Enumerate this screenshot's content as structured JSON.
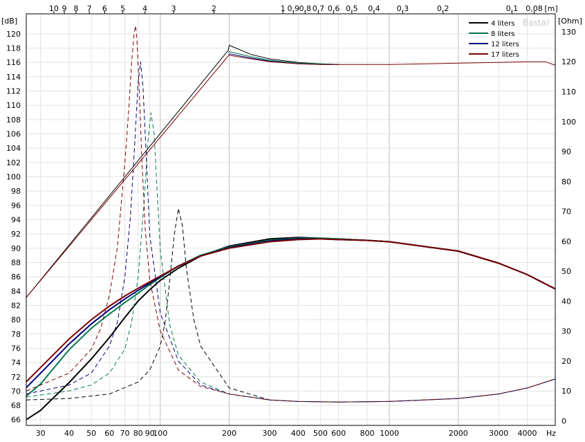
{
  "chart_data": {
    "type": "line",
    "watermark": "Basta!",
    "x_axis": {
      "unit": "Hz",
      "scale": "log",
      "range": [
        26,
        5300
      ],
      "major_ticks": [
        100,
        200,
        1000,
        2000
      ],
      "ticks": [
        {
          "value": 30,
          "label": "30"
        },
        {
          "value": 40,
          "label": "40"
        },
        {
          "value": 50,
          "label": "50"
        },
        {
          "value": 60,
          "label": "60"
        },
        {
          "value": 70,
          "label": "70"
        },
        {
          "value": 80,
          "label": "80"
        },
        {
          "value": 90,
          "label": "90"
        },
        {
          "value": 100,
          "label": "100"
        },
        {
          "value": 200,
          "label": "200"
        },
        {
          "value": 300,
          "label": "300"
        },
        {
          "value": 400,
          "label": "400"
        },
        {
          "value": 500,
          "label": "500"
        },
        {
          "value": 600,
          "label": "600"
        },
        {
          "value": 800,
          "label": "800"
        },
        {
          "value": 1000,
          "label": "1000"
        },
        {
          "value": 2000,
          "label": "2000"
        },
        {
          "value": 3000,
          "label": "3000"
        },
        {
          "value": 4000,
          "label": "4000"
        }
      ]
    },
    "x2_axis": {
      "unit": "[m]",
      "ticks": [
        {
          "value": 10,
          "label": "10"
        },
        {
          "value": 9,
          "label": "9"
        },
        {
          "value": 8,
          "label": "8"
        },
        {
          "value": 7,
          "label": "7"
        },
        {
          "value": 6,
          "label": "6"
        },
        {
          "value": 5,
          "label": "5"
        },
        {
          "value": 4,
          "label": "4"
        },
        {
          "value": 3,
          "label": "3"
        },
        {
          "value": 2,
          "label": "2"
        },
        {
          "value": 1,
          "label": "1"
        },
        {
          "value": 0.9,
          "label": "0,9"
        },
        {
          "value": 0.8,
          "label": "0,8"
        },
        {
          "value": 0.7,
          "label": "0,7"
        },
        {
          "value": 0.6,
          "label": "0,6"
        },
        {
          "value": 0.5,
          "label": "0,5"
        },
        {
          "value": 0.4,
          "label": "0,4"
        },
        {
          "value": 0.3,
          "label": "0,3"
        },
        {
          "value": 0.2,
          "label": "0,2"
        },
        {
          "value": 0.1,
          "label": "0,1"
        },
        {
          "value": 0.08,
          "label": "0,08"
        }
      ]
    },
    "y_axis": {
      "unit": "[dB]",
      "range": [
        65.2,
        122.8
      ],
      "ticks": [
        66,
        68,
        70,
        72,
        74,
        76,
        78,
        80,
        82,
        84,
        86,
        88,
        90,
        92,
        94,
        96,
        98,
        100,
        102,
        104,
        106,
        108,
        110,
        112,
        114,
        116,
        118,
        120
      ]
    },
    "y2_axis": {
      "unit": "[Ohm]",
      "range": [
        -1.5,
        136
      ],
      "ticks": [
        0,
        10,
        20,
        30,
        40,
        50,
        60,
        70,
        80,
        90,
        100,
        110,
        120,
        130
      ]
    },
    "legend": {
      "position": "top-right",
      "entries": [
        {
          "name": "4 liters",
          "color": "#000000"
        },
        {
          "name": "8 liters",
          "color": "#007a4a"
        },
        {
          "name": "12 liters",
          "color": "#00007a"
        },
        {
          "name": "17 liters",
          "color": "#7a0000"
        }
      ]
    },
    "series": [
      {
        "name": "4 liters",
        "color": "#000000",
        "axis": "left",
        "style": "solid",
        "x": [
          26,
          30,
          40,
          50,
          60,
          70,
          80,
          90,
          100,
          120,
          150,
          200,
          300,
          400,
          500,
          600,
          800,
          1000,
          2000,
          3000,
          4000,
          5300
        ],
        "y": [
          66.0,
          67.3,
          71.2,
          74.5,
          77.5,
          80.3,
          82.6,
          84.2,
          85.5,
          87.2,
          88.9,
          90.3,
          91.3,
          91.5,
          91.4,
          91.3,
          91.1,
          90.9,
          89.6,
          87.9,
          86.3,
          84.3
        ]
      },
      {
        "name": "8 liters",
        "color": "#007a4a",
        "axis": "left",
        "style": "solid",
        "x": [
          26,
          30,
          40,
          50,
          60,
          70,
          80,
          90,
          100,
          120,
          150,
          200,
          300,
          400,
          500,
          600,
          800,
          1000,
          2000,
          3000,
          4000,
          5300
        ],
        "y": [
          69.3,
          71.0,
          75.8,
          78.8,
          80.8,
          82.4,
          83.7,
          84.9,
          85.9,
          87.5,
          89.0,
          90.2,
          91.1,
          91.4,
          91.4,
          91.3,
          91.1,
          90.9,
          89.6,
          87.9,
          86.3,
          84.3
        ]
      },
      {
        "name": "12 liters",
        "color": "#00007a",
        "axis": "left",
        "style": "solid",
        "x": [
          26,
          30,
          40,
          50,
          60,
          70,
          80,
          90,
          100,
          120,
          150,
          200,
          300,
          400,
          500,
          600,
          800,
          1000,
          2000,
          3000,
          4000,
          5300
        ],
        "y": [
          70.5,
          72.5,
          76.6,
          79.4,
          81.4,
          82.9,
          84.1,
          85.1,
          86.0,
          87.5,
          88.9,
          90.1,
          91.0,
          91.3,
          91.3,
          91.2,
          91.1,
          90.9,
          89.6,
          87.9,
          86.3,
          84.3
        ]
      },
      {
        "name": "17 liters",
        "color": "#7a0000",
        "axis": "left",
        "style": "solid",
        "x": [
          26,
          30,
          40,
          50,
          60,
          70,
          80,
          90,
          100,
          120,
          150,
          200,
          300,
          400,
          500,
          600,
          800,
          1000,
          2000,
          3000,
          4000,
          5300
        ],
        "y": [
          71.3,
          73.3,
          77.3,
          80.0,
          81.9,
          83.3,
          84.4,
          85.3,
          86.1,
          87.5,
          88.9,
          90.0,
          90.9,
          91.2,
          91.3,
          91.2,
          91.1,
          90.9,
          89.6,
          87.9,
          86.3,
          84.3
        ]
      },
      {
        "name": "4 liters",
        "color": "#000000",
        "axis": "right",
        "style": "dashed",
        "x": [
          26,
          40,
          60,
          80,
          90,
          100,
          105,
          110,
          115,
          120,
          125,
          130,
          140,
          150,
          200,
          300,
          400,
          600,
          1000,
          2000,
          3000,
          4000,
          5300
        ],
        "y": [
          7.0,
          7.5,
          9.0,
          13.0,
          17.0,
          25.0,
          33.0,
          47.0,
          62.0,
          71.0,
          65.0,
          51.0,
          34.0,
          25.0,
          11.0,
          7.0,
          6.5,
          6.3,
          6.5,
          7.5,
          9.0,
          11.0,
          14.0
        ]
      },
      {
        "name": "8 liters",
        "color": "#007a4a",
        "axis": "right",
        "style": "dashed",
        "x": [
          26,
          40,
          50,
          60,
          70,
          75,
          80,
          85,
          88,
          91,
          94,
          97,
          100,
          110,
          120,
          150,
          200,
          300,
          400,
          600,
          1000,
          2000,
          3000,
          4000,
          5300
        ],
        "y": [
          8.0,
          10.0,
          12.0,
          16.0,
          24.0,
          33.0,
          48.0,
          73.0,
          92.0,
          103.0,
          96.0,
          76.0,
          57.0,
          32.0,
          22.0,
          13.0,
          9.0,
          7.0,
          6.5,
          6.3,
          6.5,
          7.5,
          9.0,
          11.0,
          14.0
        ]
      },
      {
        "name": "12 liters",
        "color": "#00007a",
        "axis": "right",
        "style": "dashed",
        "x": [
          26,
          40,
          50,
          60,
          65,
          70,
          74,
          77,
          80,
          82,
          84,
          87,
          90,
          100,
          120,
          150,
          200,
          300,
          400,
          600,
          1000,
          2000,
          3000,
          4000,
          5300
        ],
        "y": [
          9.0,
          12.0,
          16.0,
          25.0,
          33.0,
          48.0,
          68.0,
          90.0,
          113.0,
          120.0,
          112.0,
          87.0,
          62.0,
          36.0,
          20.0,
          12.0,
          9.0,
          7.0,
          6.5,
          6.3,
          6.5,
          7.5,
          9.0,
          11.0,
          14.0
        ]
      },
      {
        "name": "17 liters",
        "color": "#7a0000",
        "axis": "right",
        "style": "dashed",
        "x": [
          26,
          40,
          50,
          55,
          60,
          65,
          70,
          73,
          75,
          77,
          78,
          79,
          81,
          83,
          86,
          90,
          100,
          120,
          150,
          200,
          300,
          400,
          600,
          1000,
          2000,
          3000,
          4000,
          5300
        ],
        "y": [
          10.0,
          16.0,
          24.0,
          31.0,
          42.0,
          58.0,
          86.0,
          105.0,
          120.0,
          130.0,
          132.0,
          128.0,
          110.0,
          88.0,
          64.0,
          47.0,
          30.0,
          17.0,
          11.5,
          9.0,
          7.0,
          6.5,
          6.3,
          6.5,
          7.5,
          9.0,
          11.0,
          14.0
        ]
      },
      {
        "name": "4 liters",
        "color": "#000000",
        "axis": "left",
        "style": "thin",
        "x": [
          26,
          198,
          200,
          250,
          300,
          400,
          500,
          600
        ],
        "y": [
          83.1,
          117.7,
          118.4,
          117.1,
          116.5,
          116.0,
          115.8,
          115.7
        ]
      },
      {
        "name": "8 liters",
        "color": "#007a4a",
        "axis": "left",
        "style": "thin",
        "x": [
          198,
          200,
          250,
          300,
          400,
          500,
          600
        ],
        "y": [
          117.4,
          117.5,
          116.8,
          116.3,
          115.9,
          115.8,
          115.7
        ]
      },
      {
        "name": "12 liters",
        "color": "#00007a",
        "axis": "left",
        "style": "thin",
        "x": [
          198,
          200,
          250,
          300,
          400,
          500,
          600
        ],
        "y": [
          117.1,
          117.2,
          116.6,
          116.2,
          115.8,
          115.7,
          115.7
        ]
      },
      {
        "name": "17 liters",
        "color": "#7a0000",
        "axis": "left",
        "style": "thin",
        "x": [
          26,
          198,
          200,
          250,
          300,
          400,
          500,
          600,
          1000,
          2000,
          3000,
          4000,
          4800,
          5300
        ],
        "y": [
          83.1,
          116.9,
          117.0,
          116.5,
          116.1,
          115.8,
          115.7,
          115.7,
          115.7,
          115.9,
          116.0,
          116.1,
          116.1,
          115.6
        ]
      }
    ]
  }
}
